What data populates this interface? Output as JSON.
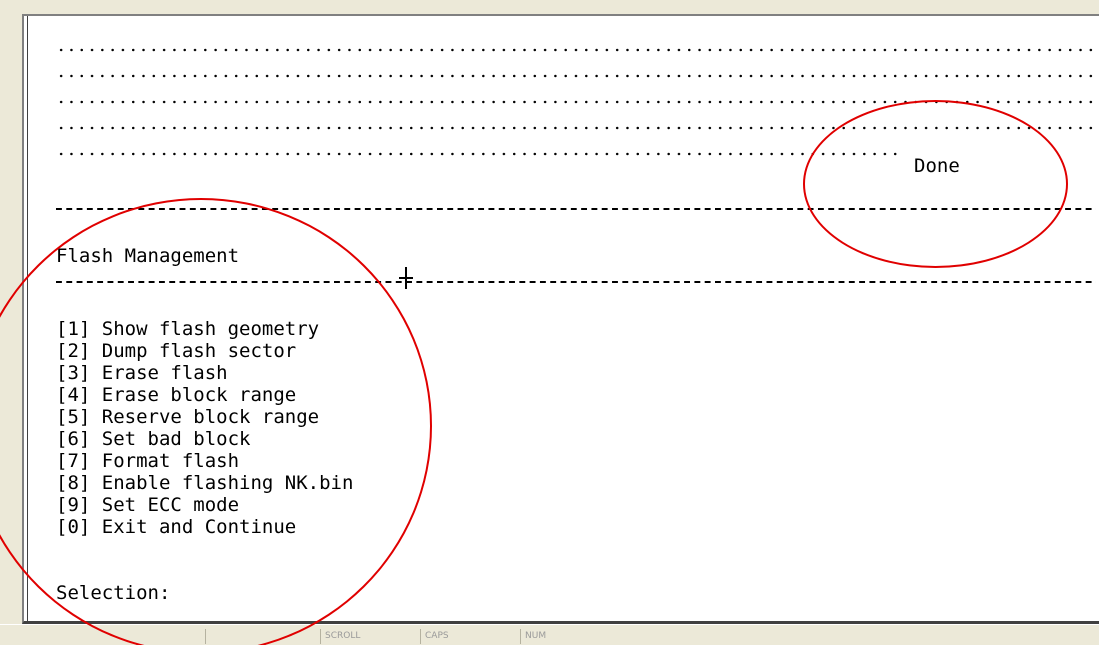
{
  "terminal": {
    "done_text": "Done",
    "menu_title": "Flash Management",
    "menu_items": [
      "[1] Show flash geometry",
      "[2] Dump flash sector",
      "[3] Erase flash",
      "[4] Erase block range",
      "[5] Reserve block range",
      "[6] Set bad block",
      "[7] Format flash",
      "[8] Enable flashing NK.bin",
      "[9] Set ECC mode",
      "[0] Exit and Continue"
    ],
    "prompt": "Selection:"
  },
  "statusbar": {
    "cells": [
      "",
      "SCROLL",
      "CAPS",
      "NUM"
    ]
  },
  "annotations": {
    "color": "#e00000"
  },
  "colors": {
    "background": "#ffffff",
    "text": "#000000",
    "chrome": "#ece9d8"
  }
}
